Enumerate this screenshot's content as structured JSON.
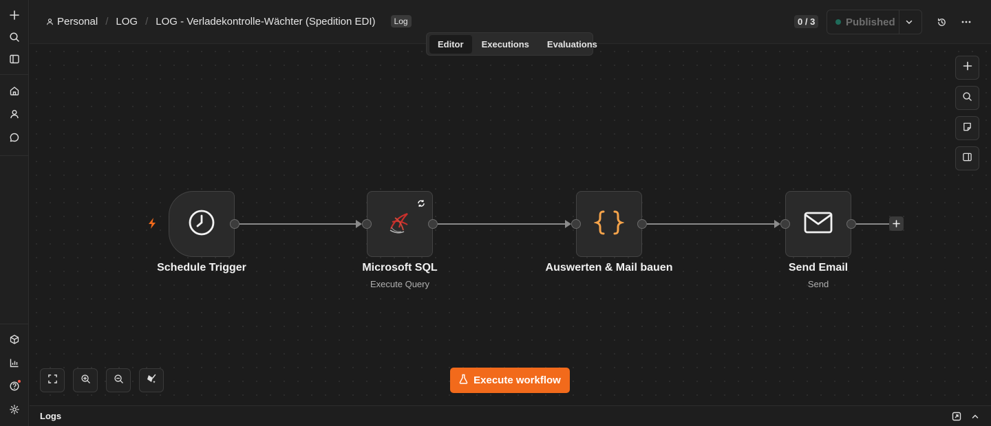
{
  "breadcrumb": {
    "owner": "Personal",
    "folder": "LOG",
    "workflow_name": "LOG - Verladekontrolle-Wächter (Spedition EDI)",
    "tag": "Log"
  },
  "header": {
    "counter": "0 / 3",
    "publish_label": "Published",
    "publish_status_color": "#1f6b5a"
  },
  "tabs": [
    {
      "label": "Editor",
      "active": true
    },
    {
      "label": "Executions",
      "active": false
    },
    {
      "label": "Evaluations",
      "active": false
    }
  ],
  "nodes": [
    {
      "title": "Schedule Trigger",
      "subtitle": "",
      "icon": "clock-icon"
    },
    {
      "title": "Microsoft SQL",
      "subtitle": "Execute Query",
      "icon": "mssql-icon"
    },
    {
      "title": "Auswerten & Mail bauen",
      "subtitle": "",
      "icon": "code-braces-icon"
    },
    {
      "title": "Send Email",
      "subtitle": "Send",
      "icon": "mail-icon"
    }
  ],
  "actions": {
    "execute_label": "Execute workflow"
  },
  "logs": {
    "label": "Logs"
  },
  "colors": {
    "accent": "#f26a1b",
    "code_icon": "#f5a34a",
    "trigger_bolt": "#f26a1b"
  }
}
